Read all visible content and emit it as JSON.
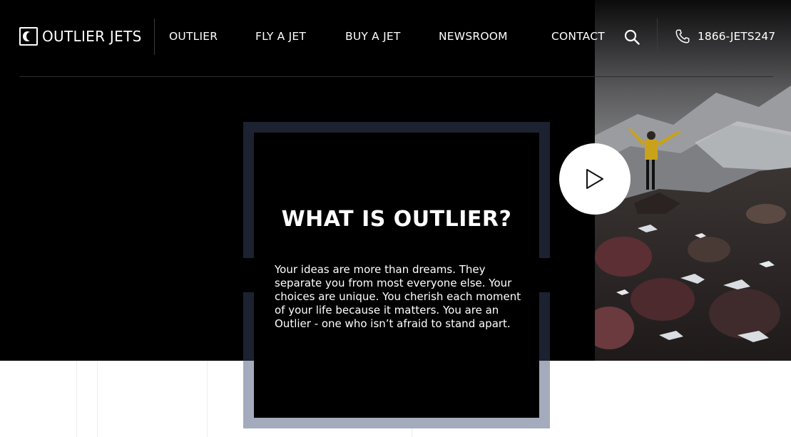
{
  "brand": {
    "name": "OUTLIER JETS"
  },
  "nav": {
    "items": [
      {
        "label": "OUTLIER"
      },
      {
        "label": "FLY A JET"
      },
      {
        "label": "BUY A JET"
      },
      {
        "label": "NEWSROOM"
      },
      {
        "label": "CONTACT"
      }
    ],
    "phone": "1866-JETS247"
  },
  "hero": {
    "title": "WHAT IS OUTLIER?",
    "body": "Your ideas are more than dreams. They separate you from most everyone else. Your choices are unique. You cherish each moment of your life because it matters. You are an Outlier - one who isn’t afraid to stand apart."
  },
  "icons": {
    "search": "search-icon",
    "phone": "phone-icon",
    "play": "play-icon",
    "logo": "logo-mark-icon"
  },
  "colors": {
    "background": "#000000",
    "frame_dark": "#1d2231",
    "frame_light": "#a3abbd",
    "text": "#ffffff"
  }
}
